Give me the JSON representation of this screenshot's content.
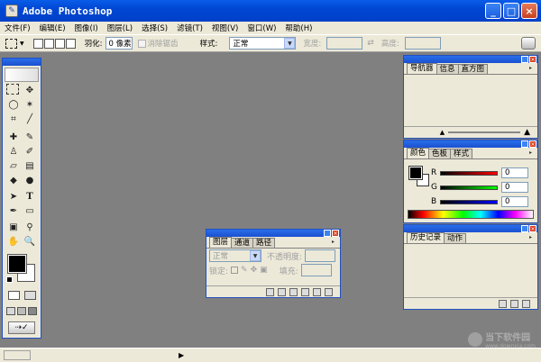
{
  "app": {
    "title": "Adobe Photoshop",
    "app_icon": "photoshop-feather-icon"
  },
  "window_buttons": {
    "minimize": "_",
    "maximize": "□",
    "close": "×"
  },
  "menu": [
    "文件(F)",
    "编辑(E)",
    "图像(I)",
    "图层(L)",
    "选择(S)",
    "滤镜(T)",
    "视图(V)",
    "窗口(W)",
    "帮助(H)"
  ],
  "options": {
    "feather_label": "羽化:",
    "feather_value": "0 像素",
    "antialias_label": "消除锯齿",
    "style_label": "样式:",
    "style_value": "正常",
    "width_label": "宽度:",
    "height_label": "高度:",
    "width_value": "",
    "height_value": ""
  },
  "navigator": {
    "tabs": [
      "导航器",
      "信息",
      "直方图"
    ],
    "active_tab": 0
  },
  "color": {
    "tabs": [
      "颜色",
      "色板",
      "样式"
    ],
    "active_tab": 0,
    "channels": [
      {
        "label": "R",
        "value": "0",
        "color": "#c00000"
      },
      {
        "label": "G",
        "value": "0",
        "color": "#00a000"
      },
      {
        "label": "B",
        "value": "0",
        "color": "#0000c0"
      }
    ],
    "foreground": "#000000",
    "background": "#ffffff"
  },
  "history": {
    "tabs": [
      "历史记录",
      "动作"
    ],
    "active_tab": 0
  },
  "layers": {
    "tabs": [
      "图层",
      "通道",
      "路径"
    ],
    "active_tab": 0,
    "blend_mode": "正常",
    "opacity_label": "不透明度:",
    "lock_label": "锁定:",
    "fill_label": "填充:"
  },
  "toolbox": {
    "foreground": "#000000",
    "background": "#ffffff"
  },
  "status": {
    "arrow": "▶"
  },
  "watermark": {
    "text": "当下软件园",
    "url": "www.downxia.com"
  },
  "colors": {
    "titlebar": "#0047d4",
    "workspace": "#808080",
    "chrome": "#ece9d8"
  }
}
